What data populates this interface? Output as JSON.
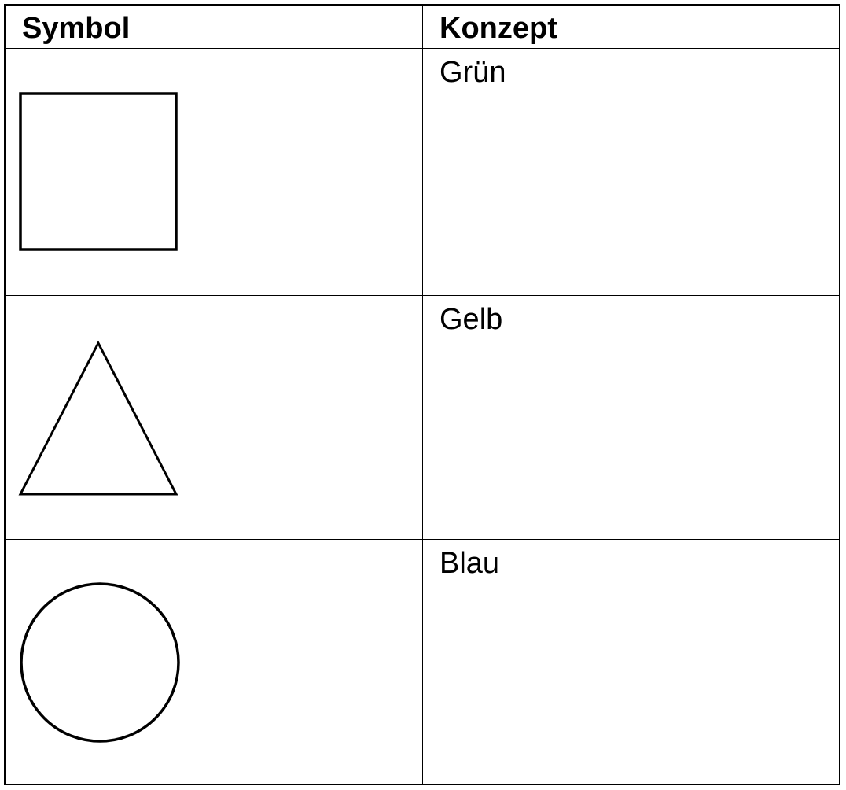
{
  "table": {
    "headers": {
      "symbol": "Symbol",
      "concept": "Konzept"
    },
    "rows": [
      {
        "symbol_icon": "square-icon",
        "concept": "Grün"
      },
      {
        "symbol_icon": "triangle-icon",
        "concept": "Gelb"
      },
      {
        "symbol_icon": "circle-icon",
        "concept": "Blau"
      }
    ]
  }
}
